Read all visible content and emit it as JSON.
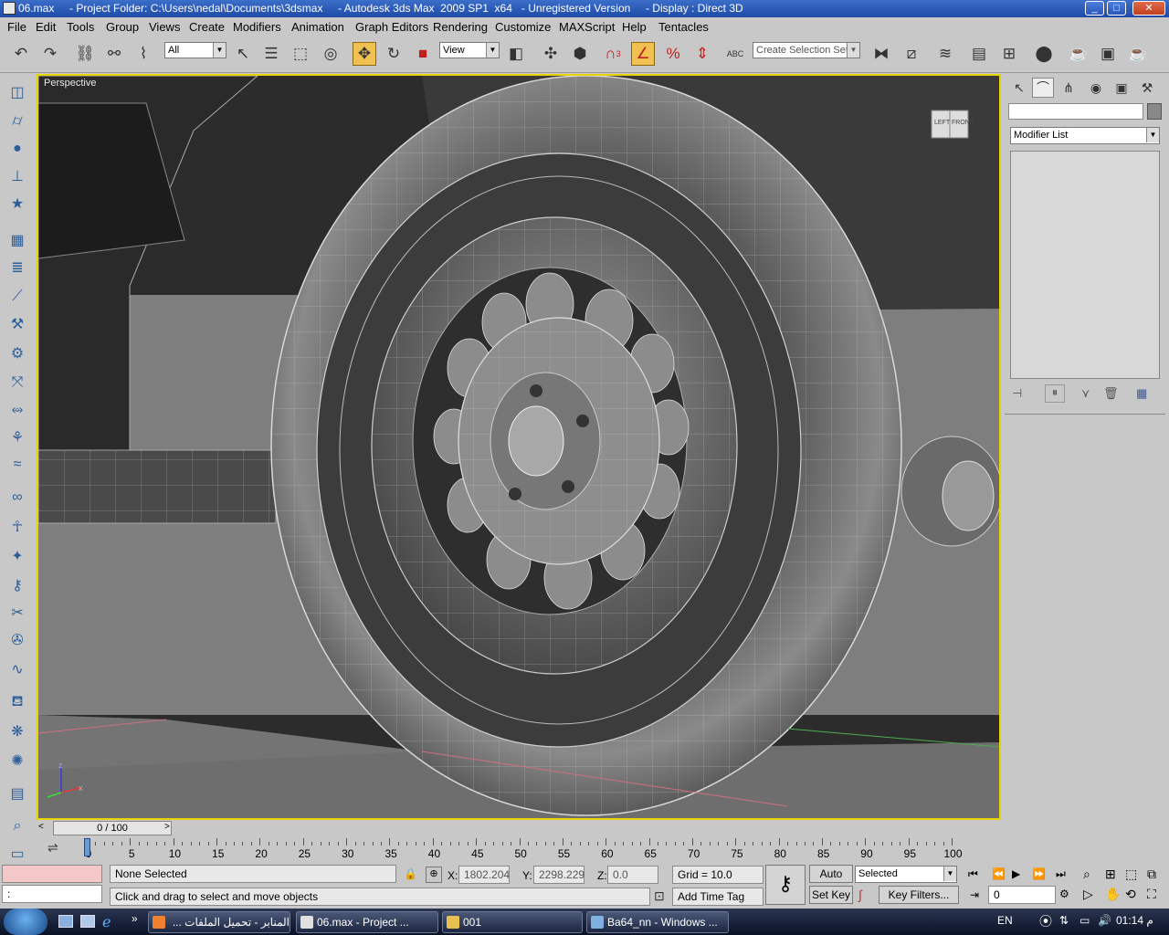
{
  "window": {
    "title": "06.max     - Project Folder: C:\\Users\\nedal\\Documents\\3dsmax     - Autodesk 3ds Max  2009 SP1  x64   - Unregistered Version     - Display : Direct 3D",
    "minimize": "_",
    "maximize": "□",
    "close": "✕"
  },
  "menu": [
    "File",
    "Edit",
    "Tools",
    "Group",
    "Views",
    "Create",
    "Modifiers",
    "Animation",
    "Graph Editors",
    "Rendering",
    "Customize",
    "MAXScript",
    "Help",
    "Tentacles"
  ],
  "toolbar": {
    "selection_filter": "All",
    "coord_system": "View",
    "selection_set_placeholder": "Create Selection Set",
    "snap_label": "3",
    "named_sel_abc": "ABC",
    "icons": [
      "undo-icon",
      "redo-icon",
      "link-icon",
      "unlink-icon",
      "bind-spacewarp-icon",
      "select-icon",
      "select-by-name-icon",
      "rect-region-icon",
      "window-crossing-icon",
      "move-icon",
      "rotate-icon",
      "scale-icon",
      "pivot-icon",
      "manipulate-icon",
      "snap-icon",
      "angle-snap-icon",
      "percent-snap-icon",
      "spinner-snap-icon",
      "edit-named-sel-icon",
      "mirror-icon",
      "align-icon",
      "layer-manager-icon",
      "curve-editor-icon",
      "schematic-icon",
      "material-editor-icon",
      "render-setup-icon",
      "rendered-frame-icon",
      "quick-render-icon"
    ]
  },
  "viewport": {
    "label": "Perspective",
    "viewcube_left": "LEFT",
    "viewcube_front": "FRONT",
    "axis_z": "z",
    "axis_x": "x"
  },
  "command_panel": {
    "modifier_list": "Modifier List",
    "name_field": ""
  },
  "timeline": {
    "slider_label": "0 / 100",
    "ticks": [
      "0",
      "5",
      "10",
      "15",
      "20",
      "25",
      "30",
      "35",
      "40",
      "45",
      "50",
      "55",
      "60",
      "65",
      "70",
      "75",
      "80",
      "85",
      "90",
      "95",
      "100"
    ]
  },
  "status": {
    "selection": "None Selected",
    "prompt": "Click and drag to select and move objects",
    "x_label": "X:",
    "x_value": "1802.204",
    "y_label": "Y:",
    "y_value": "2298.229",
    "z_label": "Z:",
    "z_value": "0.0",
    "grid": "Grid = 10.0",
    "add_time_tag": "Add Time Tag",
    "auto_key": "Auto Key",
    "set_key": "Set Key",
    "key_mode": "Selected",
    "key_filters": "Key Filters...",
    "frame": "0",
    "maxscript_prompt": ":"
  },
  "taskbar": {
    "tasks": [
      "المنابر - تحميل الملفات ...",
      "06.max     - Project ...",
      "001",
      "Ba64_nn - Windows ..."
    ],
    "lang": "EN",
    "clock": "01:14 م",
    "more": "»"
  },
  "colors": {
    "viewport_border": "#e8d400",
    "active_tool": "#f0c050",
    "title_bar": "#2a56b8",
    "taskbar": "#0b1226"
  }
}
